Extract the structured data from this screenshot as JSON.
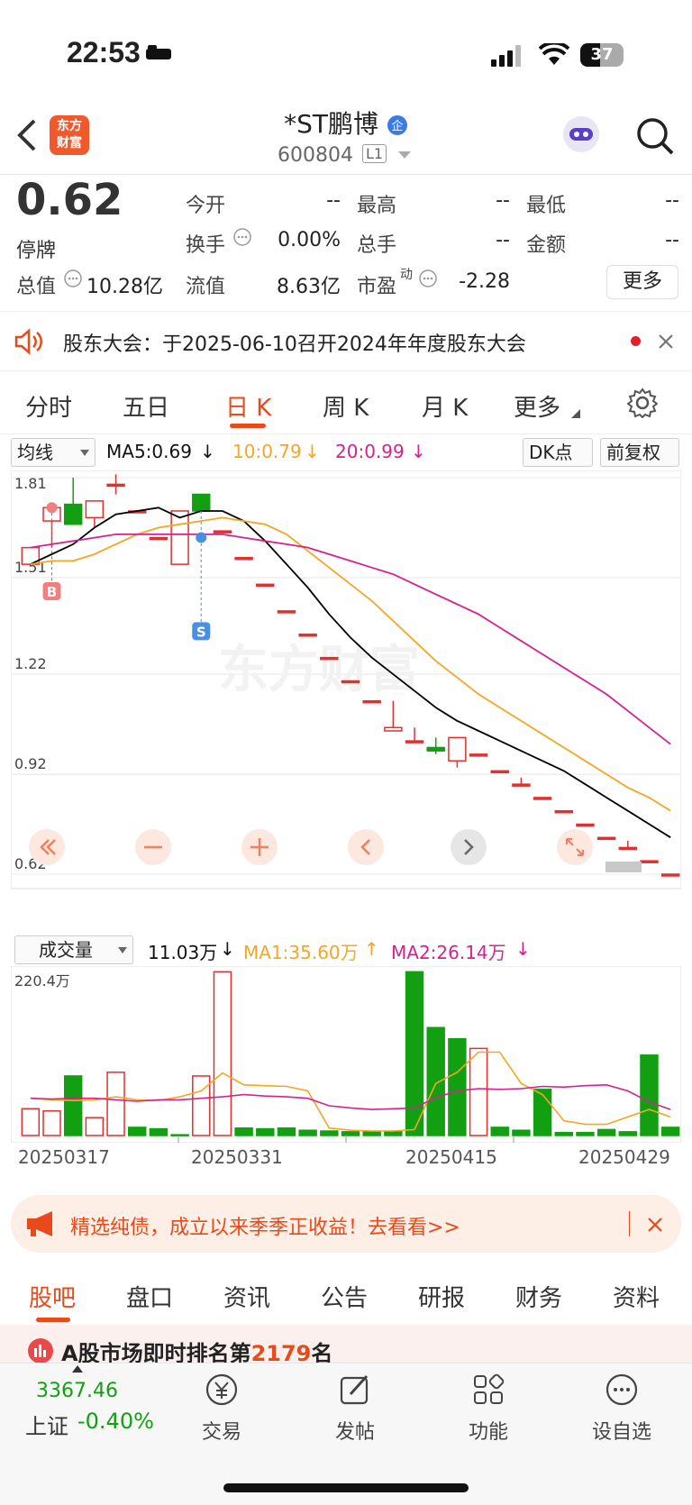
{
  "status_bar": {
    "time": "22:53",
    "battery": "37"
  },
  "header": {
    "logo_line1": "东方",
    "logo_line2": "财富",
    "stock_name": "*ST鹏博",
    "stock_code": "600804",
    "level": "L1"
  },
  "quote": {
    "price": "0.62",
    "status": "停牌",
    "open_label": "今开",
    "open_value": "--",
    "high_label": "最高",
    "high_value": "--",
    "low_label": "最低",
    "low_value": "--",
    "turnover_label": "换手",
    "turnover_value": "0.00%",
    "volume_label": "总手",
    "volume_value": "--",
    "amount_label": "金额",
    "amount_value": "--",
    "mktcap_label": "总值",
    "mktcap_value": "10.28亿",
    "float_label": "流值",
    "float_value": "8.63亿",
    "pe_label": "市盈",
    "pe_sup": "动",
    "pe_value": "-2.28",
    "more_label": "更多"
  },
  "notice": {
    "text": "股东大会：于2025-06-10召开2024年年度股东大会"
  },
  "chart_tabs": [
    "分时",
    "五日",
    "日 K",
    "周 K",
    "月 K",
    "更多"
  ],
  "indicators": {
    "ma_dropdown": "均线",
    "ma5": "MA5:0.69",
    "ma10": "10:0.79",
    "ma20": "20:0.99",
    "dk_button": "DK点",
    "adjust_button": "前复权"
  },
  "volume_indicators": {
    "dropdown": "成交量",
    "vol": "11.03万",
    "ma1": "MA1:35.60万",
    "ma2": "MA2:26.14万",
    "max_label": "220.4万"
  },
  "colors": {
    "up": "#e03030",
    "down": "#12a012",
    "ma5": "#000000",
    "ma10": "#f5a623",
    "ma20": "#d6218f",
    "accent": "#e84a1a"
  },
  "chart_data": [
    {
      "type": "candlestick",
      "title": "",
      "y_ticks": [
        "1.81",
        "1.51",
        "1.22",
        "0.92",
        "0.62"
      ],
      "ylim": [
        0.62,
        1.81
      ],
      "markers": [
        "B",
        "S"
      ],
      "ohlc": [
        {
          "o": 1.55,
          "c": 1.6,
          "h": 1.6,
          "l": 1.55
        },
        {
          "o": 1.68,
          "c": 1.72,
          "h": 1.72,
          "l": 1.6
        },
        {
          "o": 1.73,
          "c": 1.67,
          "h": 1.81,
          "l": 1.67
        },
        {
          "o": 1.69,
          "c": 1.74,
          "h": 1.74,
          "l": 1.66
        },
        {
          "o": 1.79,
          "c": 1.79,
          "h": 1.82,
          "l": 1.76
        },
        {
          "o": 1.71,
          "c": 1.71,
          "h": 1.71,
          "l": 1.71
        },
        {
          "o": 1.63,
          "c": 1.63,
          "h": 1.63,
          "l": 1.63
        },
        {
          "o": 1.55,
          "c": 1.71,
          "h": 1.71,
          "l": 1.55
        },
        {
          "o": 1.76,
          "c": 1.71,
          "h": 1.76,
          "l": 1.71
        },
        {
          "o": 1.65,
          "c": 1.65,
          "h": 1.65,
          "l": 1.65
        },
        {
          "o": 1.57,
          "c": 1.57,
          "h": 1.57,
          "l": 1.57
        },
        {
          "o": 1.49,
          "c": 1.49,
          "h": 1.49,
          "l": 1.49
        },
        {
          "o": 1.41,
          "c": 1.41,
          "h": 1.41,
          "l": 1.41
        },
        {
          "o": 1.34,
          "c": 1.34,
          "h": 1.34,
          "l": 1.34
        },
        {
          "o": 1.27,
          "c": 1.27,
          "h": 1.27,
          "l": 1.27
        },
        {
          "o": 1.2,
          "c": 1.2,
          "h": 1.2,
          "l": 1.2
        },
        {
          "o": 1.14,
          "c": 1.14,
          "h": 1.14,
          "l": 1.14
        },
        {
          "o": 1.05,
          "c": 1.06,
          "h": 1.14,
          "l": 1.05
        },
        {
          "o": 1.02,
          "c": 1.02,
          "h": 1.06,
          "l": 1.02
        },
        {
          "o": 1.0,
          "c": 0.99,
          "h": 1.03,
          "l": 0.98
        },
        {
          "o": 0.96,
          "c": 1.03,
          "h": 1.03,
          "l": 0.94
        },
        {
          "o": 0.98,
          "c": 0.98,
          "h": 0.98,
          "l": 0.98
        },
        {
          "o": 0.93,
          "c": 0.93,
          "h": 0.93,
          "l": 0.93
        },
        {
          "o": 0.89,
          "c": 0.89,
          "h": 0.91,
          "l": 0.89
        },
        {
          "o": 0.85,
          "c": 0.85,
          "h": 0.85,
          "l": 0.85
        },
        {
          "o": 0.81,
          "c": 0.81,
          "h": 0.81,
          "l": 0.81
        },
        {
          "o": 0.77,
          "c": 0.77,
          "h": 0.77,
          "l": 0.77
        },
        {
          "o": 0.73,
          "c": 0.73,
          "h": 0.73,
          "l": 0.73
        },
        {
          "o": 0.7,
          "c": 0.7,
          "h": 0.72,
          "l": 0.7
        },
        {
          "o": 0.66,
          "c": 0.66,
          "h": 0.66,
          "l": 0.66
        },
        {
          "o": 0.62,
          "c": 0.62,
          "h": 0.62,
          "l": 0.62
        }
      ],
      "ma5": [
        1.55,
        1.58,
        1.61,
        1.66,
        1.7,
        1.71,
        1.72,
        1.69,
        1.71,
        1.71,
        1.68,
        1.62,
        1.55,
        1.48,
        1.4,
        1.33,
        1.27,
        1.22,
        1.17,
        1.12,
        1.08,
        1.05,
        1.02,
        0.99,
        0.96,
        0.93,
        0.89,
        0.85,
        0.81,
        0.77,
        0.73
      ],
      "ma10": [
        1.55,
        1.56,
        1.56,
        1.58,
        1.61,
        1.64,
        1.66,
        1.67,
        1.68,
        1.69,
        1.68,
        1.67,
        1.64,
        1.59,
        1.54,
        1.49,
        1.44,
        1.38,
        1.32,
        1.26,
        1.21,
        1.16,
        1.12,
        1.08,
        1.04,
        1.0,
        0.96,
        0.92,
        0.88,
        0.85,
        0.81
      ],
      "ma20": [
        1.6,
        1.61,
        1.62,
        1.63,
        1.64,
        1.64,
        1.64,
        1.64,
        1.64,
        1.64,
        1.63,
        1.62,
        1.61,
        1.6,
        1.58,
        1.56,
        1.54,
        1.52,
        1.49,
        1.46,
        1.43,
        1.4,
        1.36,
        1.32,
        1.28,
        1.24,
        1.2,
        1.16,
        1.11,
        1.06,
        1.01
      ]
    },
    {
      "type": "bar",
      "title": "成交量",
      "x_labels": [
        "20250317",
        "20250331",
        "20250415",
        "20250429"
      ],
      "ylim": [
        0,
        220.4
      ],
      "unit": "万",
      "volumes": [
        36,
        33,
        80,
        24,
        85,
        11,
        9,
        1,
        80,
        220,
        10,
        9,
        10,
        7,
        6,
        5,
        5,
        5,
        220,
        145,
        130,
        117,
        11,
        7,
        62,
        4,
        4,
        8,
        5,
        108,
        11
      ],
      "up": [
        1,
        1,
        0,
        1,
        1,
        0,
        0,
        0,
        1,
        1,
        0,
        0,
        0,
        0,
        0,
        0,
        0,
        0,
        0,
        0,
        0,
        1,
        0,
        0,
        0,
        0,
        0,
        0,
        0,
        0,
        0
      ],
      "ma1": [
        50,
        48,
        47,
        48,
        52,
        48,
        47,
        52,
        60,
        84,
        68,
        67,
        66,
        60,
        10,
        7,
        6,
        6,
        8,
        70,
        85,
        112,
        112,
        70,
        55,
        20,
        15,
        15,
        25,
        35,
        25
      ],
      "ma2": [
        50,
        49,
        50,
        50,
        48,
        46,
        48,
        48,
        50,
        52,
        55,
        53,
        52,
        50,
        40,
        37,
        35,
        36,
        37,
        51,
        60,
        63,
        62,
        63,
        66,
        65,
        67,
        68,
        60,
        45,
        35
      ]
    }
  ],
  "ad": {
    "text": "精选纯债，成立以来季季正收益！去看看>>"
  },
  "bottom_tabs": [
    "股吧",
    "盘口",
    "资讯",
    "公告",
    "研报",
    "财务",
    "资料"
  ],
  "rank": {
    "prefix": "A股市场即时排名第",
    "number": "2179",
    "suffix": "名"
  },
  "index": {
    "value": "3367.46",
    "name": "上证",
    "change": "-0.40%"
  },
  "bottom_nav": [
    "交易",
    "发帖",
    "功能",
    "设自选"
  ]
}
